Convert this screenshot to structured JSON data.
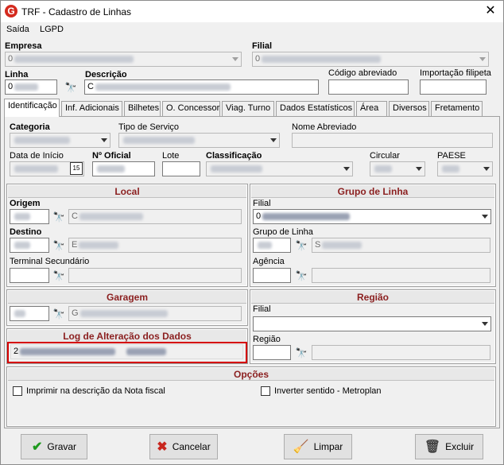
{
  "window": {
    "title": "TRF - Cadastro de Linhas"
  },
  "menu": {
    "items": [
      "Saída",
      "LGPD"
    ]
  },
  "header": {
    "empresa_label": "Empresa",
    "empresa_value": "0",
    "filial_label": "Filial",
    "filial_value": "0",
    "linha_label": "Linha",
    "linha_value": "0",
    "descricao_label": "Descrição",
    "descricao_value": "C",
    "codigo_abreviado_label": "Código abreviado",
    "importacao_label": "Importação filipeta"
  },
  "tabs": [
    "Identificação",
    "Inf. Adicionais",
    "Bilhetes",
    "O. Concessor",
    "Viag. Turno",
    "Dados Estatísticos",
    "Área",
    "Diversos",
    "Fretamento"
  ],
  "ident": {
    "categoria_label": "Categoria",
    "tipo_servico_label": "Tipo de Serviço",
    "nome_abreviado_label": "Nome Abreviado",
    "data_inicio_label": "Data de Início",
    "n_oficial_label": "Nº Oficial",
    "lote_label": "Lote",
    "classificacao_label": "Classificação",
    "circular_label": "Circular",
    "paese_label": "PAESE",
    "calendar_glyph": "15"
  },
  "local": {
    "title": "Local",
    "origem_label": "Origem",
    "origem_name": "C",
    "destino_label": "Destino",
    "destino_name": "E",
    "terminal_label": "Terminal Secundário"
  },
  "grupo_linha": {
    "title": "Grupo de Linha",
    "filial_label": "Filial",
    "filial_value": "0",
    "grupo_label": "Grupo de Linha",
    "grupo_name": "S",
    "agencia_label": "Agência"
  },
  "garagem": {
    "title": "Garagem",
    "name": "G"
  },
  "regiao": {
    "title": "Região",
    "filial_label": "Filial",
    "regiao_label": "Região"
  },
  "log": {
    "title": "Log de Alteração dos Dados",
    "value": "2"
  },
  "opcoes": {
    "title": "Opções",
    "imprimir_label": "Imprimir na descrição da Nota fiscal",
    "inverter_label": "Inverter sentido - Metroplan"
  },
  "buttons": {
    "gravar": "Gravar",
    "cancelar": "Cancelar",
    "limpar": "Limpar",
    "excluir": "Excluir"
  }
}
